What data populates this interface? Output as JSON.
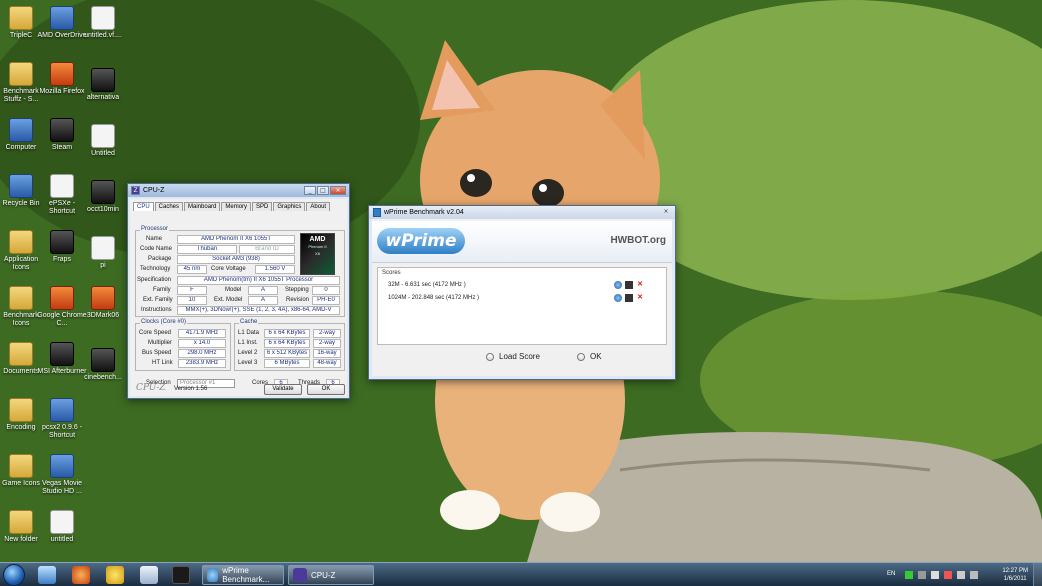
{
  "desktop": {
    "icons": [
      {
        "label": "TripleC",
        "type": "folder"
      },
      {
        "label": "AMD OverDrive",
        "type": "app"
      },
      {
        "label": "untitled.vf....",
        "type": "doc"
      },
      {
        "label": "Benchmark Stuffz - S...",
        "type": "folder"
      },
      {
        "label": "Mozilla Firefox",
        "type": "red"
      },
      {
        "label": "alternativa",
        "type": "dark"
      },
      {
        "label": "Computer",
        "type": "app"
      },
      {
        "label": "Steam",
        "type": "dark"
      },
      {
        "label": "Untitled",
        "type": "doc"
      },
      {
        "label": "Recycle Bin",
        "type": "app"
      },
      {
        "label": "ePSXe - Shortcut",
        "type": "doc"
      },
      {
        "label": "occt10min",
        "type": "dark"
      },
      {
        "label": "Application Icons",
        "type": "folder"
      },
      {
        "label": "Fraps",
        "type": "dark"
      },
      {
        "label": "pi",
        "type": "doc"
      },
      {
        "label": "Benchmark Icons",
        "type": "folder"
      },
      {
        "label": "Google Chrome C...",
        "type": "red"
      },
      {
        "label": "3DMark06",
        "type": "red"
      },
      {
        "label": "Documents",
        "type": "folder"
      },
      {
        "label": "MSI Afterburner",
        "type": "dark"
      },
      {
        "label": "cinebench...",
        "type": "dark"
      },
      {
        "label": "Encoding",
        "type": "folder"
      },
      {
        "label": "pcsx2 0.9.6 - Shortcut",
        "type": "app"
      },
      {
        "label": "Game Icons",
        "type": "folder"
      },
      {
        "label": "Vegas Movie Studio HD ...",
        "type": "app"
      },
      {
        "label": "New folder",
        "type": "folder"
      },
      {
        "label": "untitled",
        "type": "doc"
      }
    ]
  },
  "cpuz": {
    "title": "CPU-Z",
    "tabs": [
      "CPU",
      "Caches",
      "Mainboard",
      "Memory",
      "SPD",
      "Graphics",
      "About"
    ],
    "processor_group": "Processor",
    "name_label": "Name",
    "name": "AMD Phenom II X6 1055T",
    "codename_label": "Code Name",
    "codename": "Thuban",
    "brandid_label": "Brand ID",
    "package_label": "Package",
    "package": "Socket AM3 (938)",
    "technology_label": "Technology",
    "technology": "45 nm",
    "corevoltage_label": "Core Voltage",
    "corevoltage": "1.560 V",
    "specification_label": "Specification",
    "specification": "AMD Phenom(tm) II X6 1055T Processor",
    "family_label": "Family",
    "family": "F",
    "model_label": "Model",
    "model": "A",
    "stepping_label": "Stepping",
    "stepping": "0",
    "extfamily_label": "Ext. Family",
    "extfamily": "10",
    "extmodel_label": "Ext. Model",
    "extmodel": "A",
    "revision_label": "Revision",
    "revision": "PH-E0",
    "instructions_label": "Instructions",
    "instructions": "MMX(+), 3DNow!(+), SSE (1, 2, 3, 4A), x86-64, AMD-V",
    "clocks_group": "Clocks (Core #0)",
    "corespeed_label": "Core Speed",
    "corespeed": "4171.9 MHz",
    "multiplier_label": "Multiplier",
    "multiplier": "x 14.0",
    "busspeed_label": "Bus Speed",
    "busspeed": "298.0 MHz",
    "htlink_label": "HT Link",
    "htlink": "2383.9 MHz",
    "cache_group": "Cache",
    "l1data_label": "L1 Data",
    "l1data": "6 x 64 KBytes",
    "l1data_way": "2-way",
    "l1inst_label": "L1 Inst.",
    "l1inst": "6 x 64 KBytes",
    "l1inst_way": "2-way",
    "level2_label": "Level 2",
    "level2": "6 x 512 KBytes",
    "level2_way": "16-way",
    "level3_label": "Level 3",
    "level3": "6 MBytes",
    "level3_way": "48-way",
    "selection_label": "Selection",
    "selection": "Processor #1",
    "cores_label": "Cores",
    "cores": "6",
    "threads_label": "Threads",
    "threads": "6",
    "brand": "CPU-Z",
    "version": "Version 1.56",
    "validate": "Validate",
    "ok": "OK",
    "logo_text": "AMD",
    "logo_sub": "Phenom II",
    "logo_x6": "X6"
  },
  "wprime": {
    "title": "wPrime Benchmark v2.04",
    "logo": "wPrime",
    "hwbot": "HWBOT.org",
    "scores_label": "Scores",
    "scores": [
      "32M - 6.631 sec (4172 MHz )",
      "1024M - 202.848 sec (4172 MHz )"
    ],
    "load_score": "Load Score",
    "ok": "OK"
  },
  "taskbar": {
    "tasks": [
      {
        "label": "wPrime Benchmark..."
      },
      {
        "label": "CPU-Z"
      }
    ],
    "lang": "EN",
    "time": "12:27 PM",
    "date": "1/6/2011"
  }
}
